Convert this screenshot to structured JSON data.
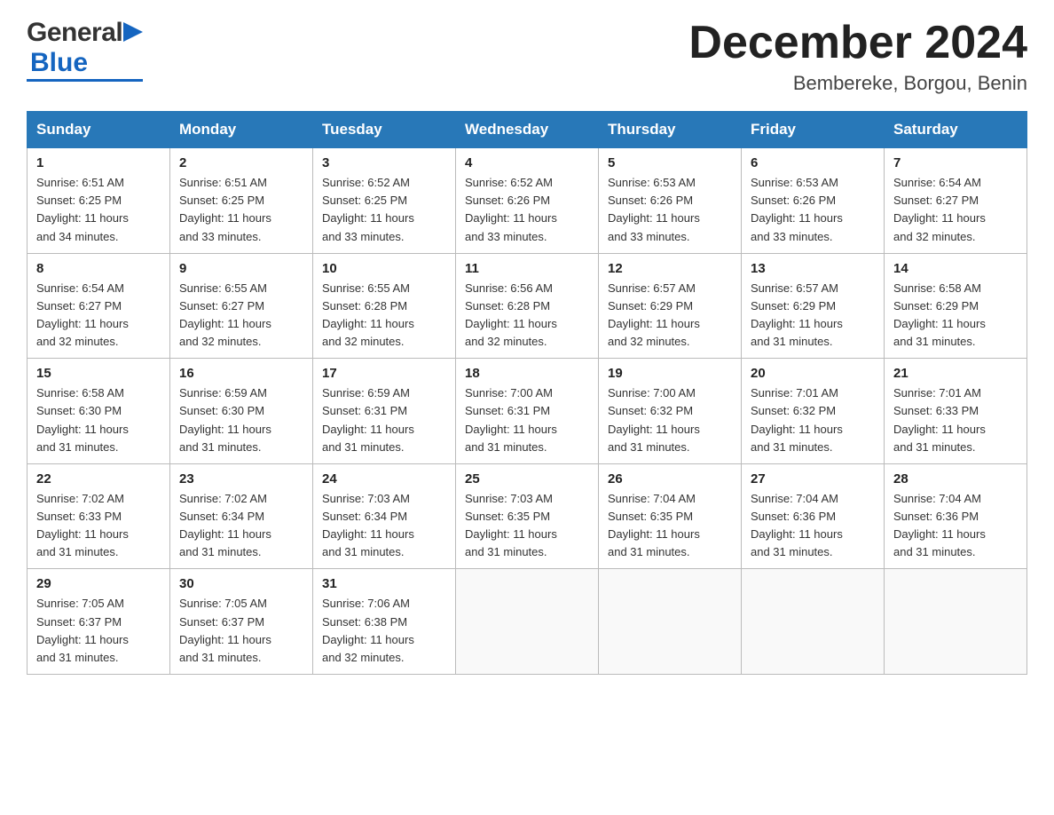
{
  "header": {
    "logo_general": "General",
    "logo_blue": "Blue",
    "month_year": "December 2024",
    "location": "Bembereke, Borgou, Benin"
  },
  "days_of_week": [
    "Sunday",
    "Monday",
    "Tuesday",
    "Wednesday",
    "Thursday",
    "Friday",
    "Saturday"
  ],
  "weeks": [
    [
      {
        "day": "1",
        "sunrise": "6:51 AM",
        "sunset": "6:25 PM",
        "daylight": "11 hours and 34 minutes."
      },
      {
        "day": "2",
        "sunrise": "6:51 AM",
        "sunset": "6:25 PM",
        "daylight": "11 hours and 33 minutes."
      },
      {
        "day": "3",
        "sunrise": "6:52 AM",
        "sunset": "6:25 PM",
        "daylight": "11 hours and 33 minutes."
      },
      {
        "day": "4",
        "sunrise": "6:52 AM",
        "sunset": "6:26 PM",
        "daylight": "11 hours and 33 minutes."
      },
      {
        "day": "5",
        "sunrise": "6:53 AM",
        "sunset": "6:26 PM",
        "daylight": "11 hours and 33 minutes."
      },
      {
        "day": "6",
        "sunrise": "6:53 AM",
        "sunset": "6:26 PM",
        "daylight": "11 hours and 33 minutes."
      },
      {
        "day": "7",
        "sunrise": "6:54 AM",
        "sunset": "6:27 PM",
        "daylight": "11 hours and 32 minutes."
      }
    ],
    [
      {
        "day": "8",
        "sunrise": "6:54 AM",
        "sunset": "6:27 PM",
        "daylight": "11 hours and 32 minutes."
      },
      {
        "day": "9",
        "sunrise": "6:55 AM",
        "sunset": "6:27 PM",
        "daylight": "11 hours and 32 minutes."
      },
      {
        "day": "10",
        "sunrise": "6:55 AM",
        "sunset": "6:28 PM",
        "daylight": "11 hours and 32 minutes."
      },
      {
        "day": "11",
        "sunrise": "6:56 AM",
        "sunset": "6:28 PM",
        "daylight": "11 hours and 32 minutes."
      },
      {
        "day": "12",
        "sunrise": "6:57 AM",
        "sunset": "6:29 PM",
        "daylight": "11 hours and 32 minutes."
      },
      {
        "day": "13",
        "sunrise": "6:57 AM",
        "sunset": "6:29 PM",
        "daylight": "11 hours and 31 minutes."
      },
      {
        "day": "14",
        "sunrise": "6:58 AM",
        "sunset": "6:29 PM",
        "daylight": "11 hours and 31 minutes."
      }
    ],
    [
      {
        "day": "15",
        "sunrise": "6:58 AM",
        "sunset": "6:30 PM",
        "daylight": "11 hours and 31 minutes."
      },
      {
        "day": "16",
        "sunrise": "6:59 AM",
        "sunset": "6:30 PM",
        "daylight": "11 hours and 31 minutes."
      },
      {
        "day": "17",
        "sunrise": "6:59 AM",
        "sunset": "6:31 PM",
        "daylight": "11 hours and 31 minutes."
      },
      {
        "day": "18",
        "sunrise": "7:00 AM",
        "sunset": "6:31 PM",
        "daylight": "11 hours and 31 minutes."
      },
      {
        "day": "19",
        "sunrise": "7:00 AM",
        "sunset": "6:32 PM",
        "daylight": "11 hours and 31 minutes."
      },
      {
        "day": "20",
        "sunrise": "7:01 AM",
        "sunset": "6:32 PM",
        "daylight": "11 hours and 31 minutes."
      },
      {
        "day": "21",
        "sunrise": "7:01 AM",
        "sunset": "6:33 PM",
        "daylight": "11 hours and 31 minutes."
      }
    ],
    [
      {
        "day": "22",
        "sunrise": "7:02 AM",
        "sunset": "6:33 PM",
        "daylight": "11 hours and 31 minutes."
      },
      {
        "day": "23",
        "sunrise": "7:02 AM",
        "sunset": "6:34 PM",
        "daylight": "11 hours and 31 minutes."
      },
      {
        "day": "24",
        "sunrise": "7:03 AM",
        "sunset": "6:34 PM",
        "daylight": "11 hours and 31 minutes."
      },
      {
        "day": "25",
        "sunrise": "7:03 AM",
        "sunset": "6:35 PM",
        "daylight": "11 hours and 31 minutes."
      },
      {
        "day": "26",
        "sunrise": "7:04 AM",
        "sunset": "6:35 PM",
        "daylight": "11 hours and 31 minutes."
      },
      {
        "day": "27",
        "sunrise": "7:04 AM",
        "sunset": "6:36 PM",
        "daylight": "11 hours and 31 minutes."
      },
      {
        "day": "28",
        "sunrise": "7:04 AM",
        "sunset": "6:36 PM",
        "daylight": "11 hours and 31 minutes."
      }
    ],
    [
      {
        "day": "29",
        "sunrise": "7:05 AM",
        "sunset": "6:37 PM",
        "daylight": "11 hours and 31 minutes."
      },
      {
        "day": "30",
        "sunrise": "7:05 AM",
        "sunset": "6:37 PM",
        "daylight": "11 hours and 31 minutes."
      },
      {
        "day": "31",
        "sunrise": "7:06 AM",
        "sunset": "6:38 PM",
        "daylight": "11 hours and 32 minutes."
      },
      null,
      null,
      null,
      null
    ]
  ],
  "labels": {
    "sunrise": "Sunrise:",
    "sunset": "Sunset:",
    "daylight": "Daylight:"
  }
}
